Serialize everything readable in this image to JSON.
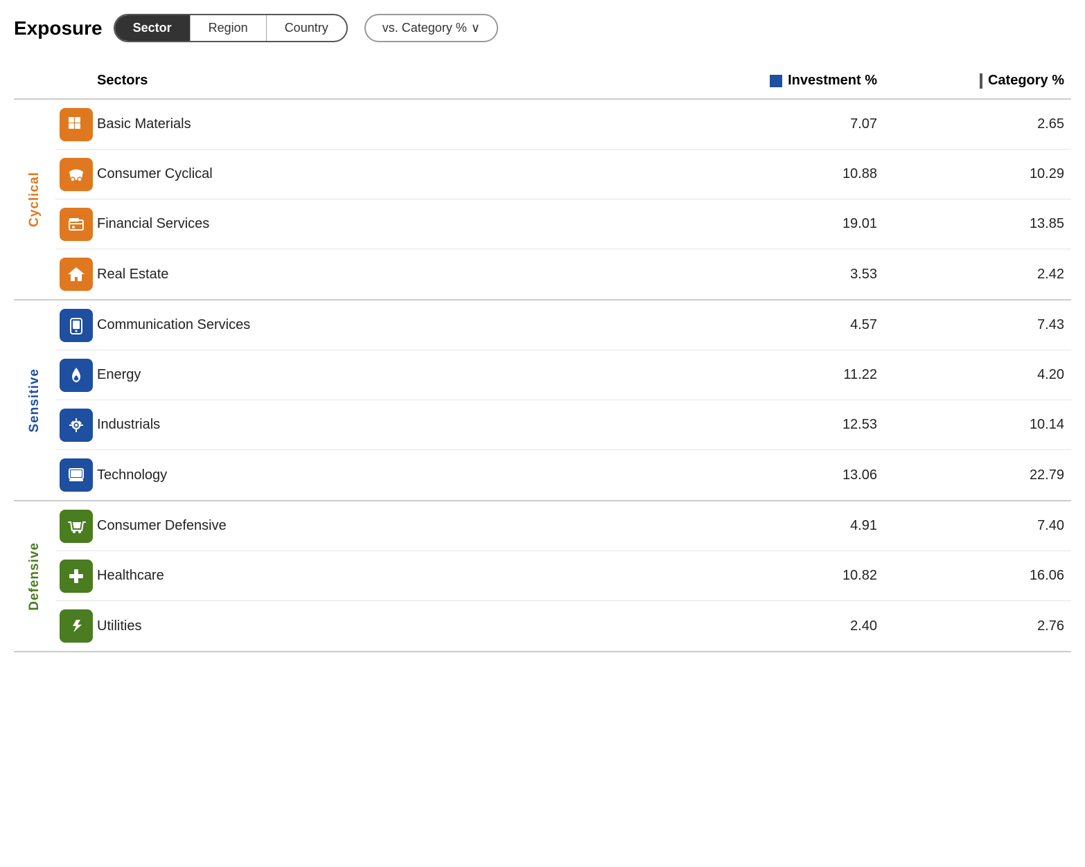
{
  "header": {
    "title": "Exposure",
    "tabs": [
      {
        "id": "sector",
        "label": "Sector",
        "active": true
      },
      {
        "id": "region",
        "label": "Region",
        "active": false
      },
      {
        "id": "country",
        "label": "Country",
        "active": false
      }
    ],
    "vs_button": "vs. Category %",
    "vs_chevron": "∨"
  },
  "table": {
    "col_sectors": "Sectors",
    "col_investment": "Investment  %",
    "col_category": "Category  %",
    "groups": [
      {
        "id": "cyclical",
        "label": "Cyclical",
        "color_class": "cyclical",
        "icon_class": "icon-orange",
        "rows": [
          {
            "icon": "⊞",
            "icon_unicode": "⊞",
            "name": "Basic Materials",
            "investment": "7.07",
            "category": "2.65",
            "icon_symbol": "⊞"
          },
          {
            "icon": "🚗",
            "name": "Consumer Cyclical",
            "investment": "10.88",
            "category": "10.29",
            "icon_symbol": "🚗"
          },
          {
            "icon": "💳",
            "name": "Financial Services",
            "investment": "19.01",
            "category": "13.85",
            "icon_symbol": "💳"
          },
          {
            "icon": "🏠",
            "name": "Real Estate",
            "investment": "3.53",
            "category": "2.42",
            "icon_symbol": "🏠"
          }
        ]
      },
      {
        "id": "sensitive",
        "label": "Sensitive",
        "color_class": "sensitive",
        "icon_class": "icon-blue",
        "rows": [
          {
            "icon": "📱",
            "name": "Communication Services",
            "investment": "4.57",
            "category": "7.43",
            "icon_symbol": "📱"
          },
          {
            "icon": "🔥",
            "name": "Energy",
            "investment": "11.22",
            "category": "4.20",
            "icon_symbol": "🔥"
          },
          {
            "icon": "⚙️",
            "name": "Industrials",
            "investment": "12.53",
            "category": "10.14",
            "icon_symbol": "⚙️"
          },
          {
            "icon": "🖥",
            "name": "Technology",
            "investment": "13.06",
            "category": "22.79",
            "icon_symbol": "🖥"
          }
        ]
      },
      {
        "id": "defensive",
        "label": "Defensive",
        "color_class": "defensive",
        "icon_class": "icon-green",
        "rows": [
          {
            "icon": "🛒",
            "name": "Consumer Defensive",
            "investment": "4.91",
            "category": "7.40",
            "icon_symbol": "🛒"
          },
          {
            "icon": "➕",
            "name": "Healthcare",
            "investment": "10.82",
            "category": "16.06",
            "icon_symbol": "➕"
          },
          {
            "icon": "💡",
            "name": "Utilities",
            "investment": "2.40",
            "category": "2.76",
            "icon_symbol": "💡"
          }
        ]
      }
    ]
  }
}
